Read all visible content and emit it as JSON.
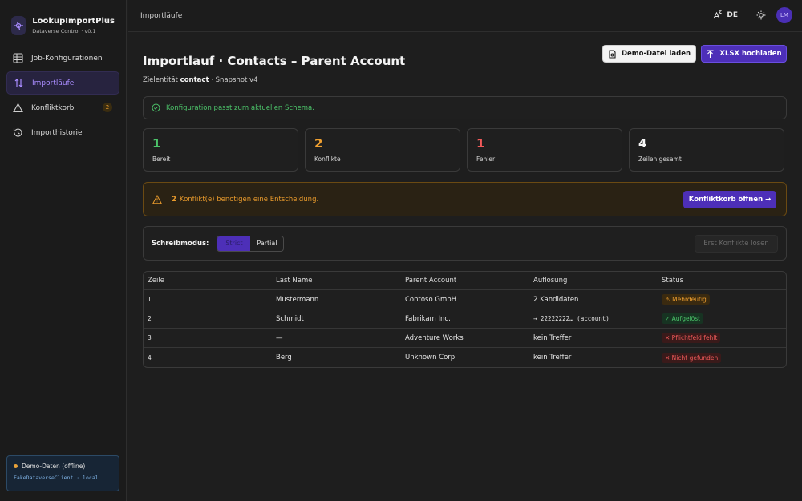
{
  "app": {
    "title": "LookupImportPlus",
    "subtitle": "Dataverse Control · v0.1"
  },
  "sidebar": {
    "items": [
      {
        "label": "Job-Konfigurationen",
        "icon": "grid-icon"
      },
      {
        "label": "Importläufe",
        "icon": "arrows-updown-icon"
      },
      {
        "label": "Konfliktkorb",
        "icon": "warning-icon",
        "badge": "2"
      },
      {
        "label": "Importhistorie",
        "icon": "history-icon"
      }
    ],
    "demo": {
      "title": "Demo-Daten (offline)",
      "code": "FakeDataverseClient · local"
    }
  },
  "topbar": {
    "title": "Importläufe",
    "lang": "DE",
    "avatar": "LM"
  },
  "page": {
    "title": "Importlauf · Contacts – Parent Account",
    "sub_prefix": "Zielentität",
    "entity": "contact",
    "sub_suffix": "· Snapshot v4",
    "btn_demo": "Demo-Datei laden",
    "btn_upload": "XLSX hochladen"
  },
  "schema": {
    "message": "Konfiguration passt zum aktuellen Schema."
  },
  "stats": [
    {
      "value": "1",
      "label": "Bereit",
      "color": "#4cc46a"
    },
    {
      "value": "2",
      "label": "Konflikte",
      "color": "#f0a030"
    },
    {
      "value": "1",
      "label": "Fehler",
      "color": "#f05a5a"
    },
    {
      "value": "4",
      "label": "Zeilen gesamt",
      "color": "#f4f4f4"
    }
  ],
  "conflict": {
    "count": "2",
    "message": "Konflikt(e) benötigen eine Entscheidung.",
    "button": "Konfliktkorb öffnen →"
  },
  "mode": {
    "label": "Schreibmodus:",
    "options": [
      "Strict",
      "Partial"
    ],
    "selected": "Strict",
    "resolve_button": "Erst Konflikte lösen"
  },
  "table": {
    "headers": [
      "Zeile",
      "Last Name",
      "Parent Account",
      "Auflösung",
      "Status"
    ],
    "rows": [
      {
        "row": "1",
        "last_name": "Mustermann",
        "parent": "Contoso GmbH",
        "resolution": "2 Kandidaten",
        "status": "⚠ Mehrdeutig",
        "kind": "warn"
      },
      {
        "row": "2",
        "last_name": "Schmidt",
        "parent": "Fabrikam Inc.",
        "resolution": "→ 22222222… (account)",
        "status": "✓ Aufgelöst",
        "kind": "ok"
      },
      {
        "row": "3",
        "last_name": "—",
        "parent": "Adventure Works",
        "resolution": "kein Treffer",
        "status": "✕ Pflichtfeld fehlt",
        "kind": "err"
      },
      {
        "row": "4",
        "last_name": "Berg",
        "parent": "Unknown Corp",
        "resolution": "kein Treffer",
        "status": "✕ Nicht gefunden",
        "kind": "err"
      }
    ]
  }
}
